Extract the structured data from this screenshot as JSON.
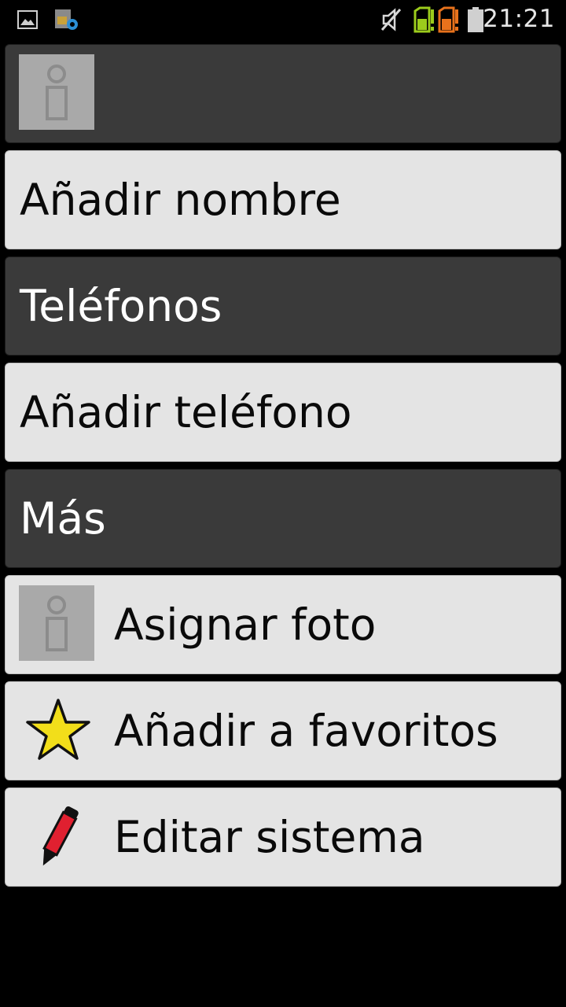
{
  "status_bar": {
    "time": "21:21",
    "icons": [
      "image-notification-icon",
      "sim-settings-icon",
      "mute-icon",
      "sim1-signal-icon",
      "sim2-signal-icon",
      "battery-icon"
    ],
    "colors": {
      "sim1": "#9ccc1c",
      "sim2": "#e8721c"
    }
  },
  "contact": {
    "photo_icon": "contact-placeholder-icon",
    "add_name_label": "Añadir nombre"
  },
  "phones_section": {
    "header": "Teléfonos",
    "add_phone_label": "Añadir teléfono"
  },
  "more_section": {
    "header": "Más",
    "items": [
      {
        "label": "Asignar foto",
        "icon": "contact-placeholder-icon"
      },
      {
        "label": "Añadir a favoritos",
        "icon": "star-icon"
      },
      {
        "label": "Editar sistema",
        "icon": "pencil-icon"
      }
    ]
  },
  "colors": {
    "dark_row": "#3a3a3a",
    "light_row": "#e4e4e4",
    "star": "#f2de1a"
  }
}
